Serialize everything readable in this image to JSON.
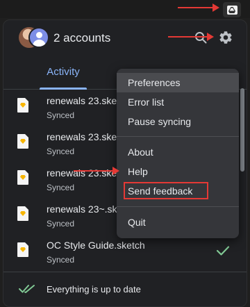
{
  "header": {
    "accounts_title": "2 accounts"
  },
  "tabs": {
    "activity": "Activity"
  },
  "files": [
    {
      "name": "renewals 23.sketch",
      "status": "Synced"
    },
    {
      "name": "renewals 23.sketch",
      "status": "Synced"
    },
    {
      "name": "renewals 23.sketch",
      "status": "Synced"
    },
    {
      "name": "renewals 23~.sketch",
      "status": "Synced"
    },
    {
      "name": "OC Style Guide.sketch",
      "status": "Synced"
    }
  ],
  "footer": {
    "status_text": "Everything is up to date"
  },
  "menu": {
    "preferences": "Preferences",
    "error_list": "Error list",
    "pause_syncing": "Pause syncing",
    "about": "About",
    "help": "Help",
    "send_feedback": "Send feedback",
    "quit": "Quit"
  },
  "colors": {
    "accent": "#8ab4f8",
    "annotation_red": "#e53935",
    "check_green": "#81c995"
  },
  "icons": {
    "tray": "google-drive-icon",
    "search": "search-icon",
    "settings": "gear-icon",
    "file": "sketch-file-icon",
    "synced": "check-icon",
    "up_to_date": "double-check-icon"
  }
}
